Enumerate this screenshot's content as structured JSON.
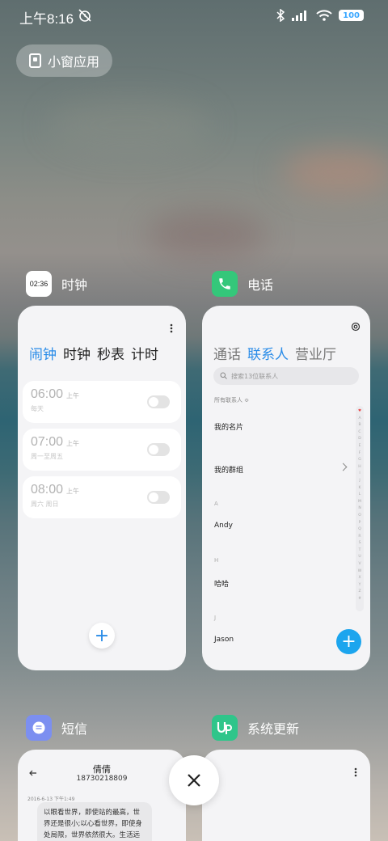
{
  "status": {
    "time": "上午8:16",
    "battery": "100"
  },
  "small_window": {
    "label": "小窗应用"
  },
  "apps": {
    "clock": {
      "name": "时钟",
      "icon_text": "02:36",
      "tabs": [
        "闹钟",
        "时钟",
        "秒表",
        "计时"
      ],
      "alarms": [
        {
          "time": "06:00",
          "ampm": "上午",
          "repeat": "每天"
        },
        {
          "time": "07:00",
          "ampm": "上午",
          "repeat": "周一至周五"
        },
        {
          "time": "08:00",
          "ampm": "上午",
          "repeat": "周六 周日"
        }
      ],
      "add": "+"
    },
    "phone": {
      "name": "电话",
      "tabs": [
        "通话",
        "联系人",
        "营业厅"
      ],
      "search_placeholder": "搜索13位联系人",
      "all_contacts": "所有联系人 ≎",
      "my_card": "我的名片",
      "my_groups": "我的群组",
      "letters": [
        "A",
        "H",
        "J"
      ],
      "contacts": [
        "Andy",
        "哈哈",
        "Jason"
      ],
      "index": [
        "♥",
        "A",
        "B",
        "C",
        "D",
        "E",
        "F",
        "G",
        "H",
        "I",
        "J",
        "K",
        "L",
        "M",
        "N",
        "O",
        "P",
        "Q",
        "R",
        "S",
        "T",
        "U",
        "V",
        "W",
        "X",
        "Y",
        "Z",
        "#"
      ],
      "add": "+"
    },
    "sms": {
      "name": "短信",
      "contact_name": "倩倩",
      "contact_number": "18730218809",
      "date": "2016-6-13 下午1:49",
      "message": "以眼看世界，即使站的最高，世界还是很小;以心看世界，即使身处局限，世界依然很大。生活远"
    },
    "update": {
      "name": "系统更新"
    }
  },
  "colors": {
    "accent": "#2a8ce8",
    "phone_icon": "#34c77a",
    "sms_icon": "#7c8ff0",
    "update_icon": "#2fc58a",
    "fab_blue": "#1ca5ee"
  }
}
